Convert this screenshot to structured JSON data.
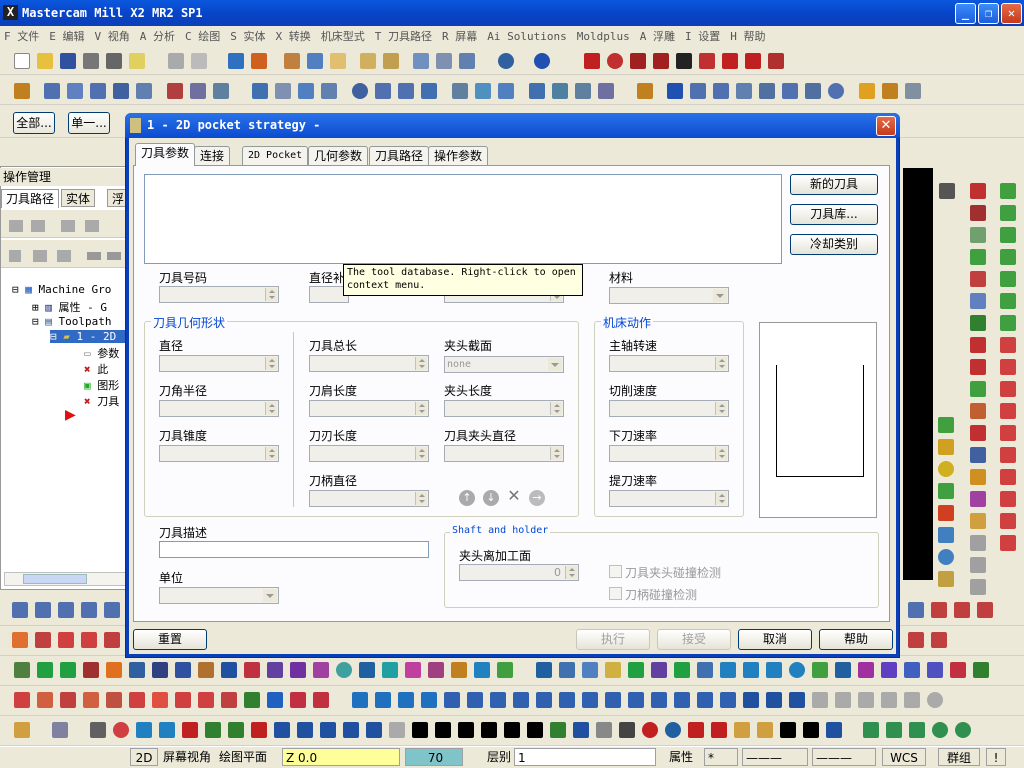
{
  "app": {
    "title": "Mastercam Mill  X2 MR2 SP1",
    "logo": "X"
  },
  "menu": [
    "F 文件",
    "E 编辑",
    "V 视角",
    "A 分析",
    "C 绘图",
    "S 实体",
    "X 转换",
    "机床型式",
    "T 刀具路径",
    "R 屏幕",
    "Ai Solutions",
    "Moldplus",
    "A 浮雕",
    "I 设置",
    "H 帮助"
  ],
  "left_buttons": {
    "all": "全部...",
    "single": "单一..."
  },
  "ops_manager": {
    "title": "操作管理",
    "tabs": [
      "刀具路径",
      "实体",
      "浮"
    ],
    "tree": [
      "Machine Gro",
      "属性 - G",
      "Toolpath",
      "1 - 2D",
      "参数",
      "此",
      "图形",
      "刀具"
    ]
  },
  "dialog": {
    "title": "1 - 2D pocket strategy -",
    "tabs": [
      "刀具参数",
      "连接",
      "2D Pocket",
      "几何参数",
      "刀具路径",
      "操作参数"
    ],
    "side_buttons": [
      "新的刀具",
      "刀具库...",
      "冷却类别"
    ],
    "tooltip": "The tool database. Right-click to open context menu.",
    "labels": {
      "tool_number": "刀具号码",
      "diameter_comp": "直径补",
      "material": "材料",
      "group_geom": "刀具几何形状",
      "diameter": "直径",
      "corner_radius": "刀角半径",
      "taper": "刀具锥度",
      "overall_length": "刀具总长",
      "shoulder_length": "刀肩长度",
      "flute_length": "刀刃长度",
      "shank_diameter": "刀柄直径",
      "holder_section": "夹头截面",
      "holder_length": "夹头长度",
      "holder_diameter": "刀具夹头直径",
      "group_machine": "机床动作",
      "spindle_speed": "主轴转速",
      "feed_rate": "切削速度",
      "plunge_rate": "下刀速率",
      "retract_rate": "提刀速率",
      "description": "刀具描述",
      "units": "单位",
      "group_shaft": "Shaft and holder",
      "holder_distance": "夹头离加工面",
      "holder_collision": "刀具夹头碰撞检测",
      "shank_collision": "刀柄碰撞检测"
    },
    "holder_section_value": "none",
    "holder_distance_value": "0",
    "bottom_buttons": {
      "reset": "重置",
      "execute": "执行",
      "accept": "接受",
      "cancel": "取消",
      "help": "帮助"
    }
  },
  "statusbar": {
    "mode": "2D",
    "view": "屏幕视角",
    "plane": "绘图平面",
    "z": "Z 0.0",
    "color": "70",
    "level_label": "层别",
    "level": "1",
    "attrib": "属性",
    "wcs": "WCS",
    "group": "群组"
  }
}
